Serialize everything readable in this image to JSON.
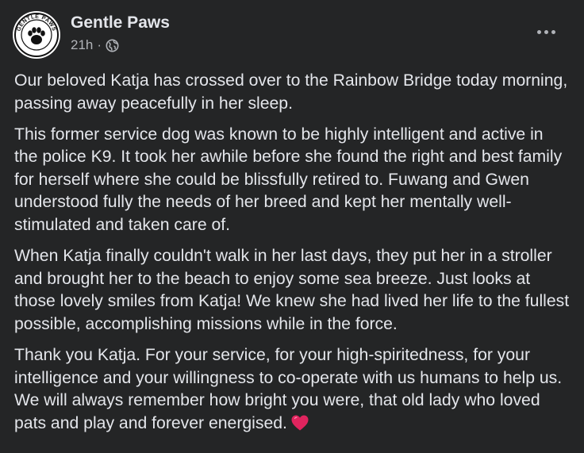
{
  "post": {
    "author": "Gentle Paws",
    "time": "21h",
    "separator": "·",
    "privacy_icon": "globe-icon",
    "avatar_label": "GENTLE PAWS",
    "more_icon": "more-options-icon",
    "paragraphs": [
      "Our beloved Katja has crossed over to the Rainbow Bridge today morning, passing away peacefully in her sleep.",
      "This former service dog was known to be highly intelligent and active in the police K9. It took her awhile before she found the right and best family for herself where she could be blissfully retired to. Fuwang and Gwen understood fully the needs of her breed and kept her mentally well-stimulated and taken care of.",
      "When Katja finally couldn't walk in her last days, they put her in a stroller and brought her to the beach to enjoy some sea breeze. Just looks at those lovely smiles from Katja! We knew she had lived her life to the fullest possible, accomplishing missions while in the force.",
      "Thank you Katja. For your service, for your high-spiritedness, for your intelligence and your willingness to co-operate with us humans to help us. We will always remember how bright you were, that old lady who loved pats and play and forever energised."
    ],
    "heart_icon": "red-heart-icon"
  },
  "colors": {
    "background": "#242526",
    "primary_text": "#e4e6eb",
    "secondary_text": "#b0b3b8",
    "heart": "#e0245e"
  }
}
